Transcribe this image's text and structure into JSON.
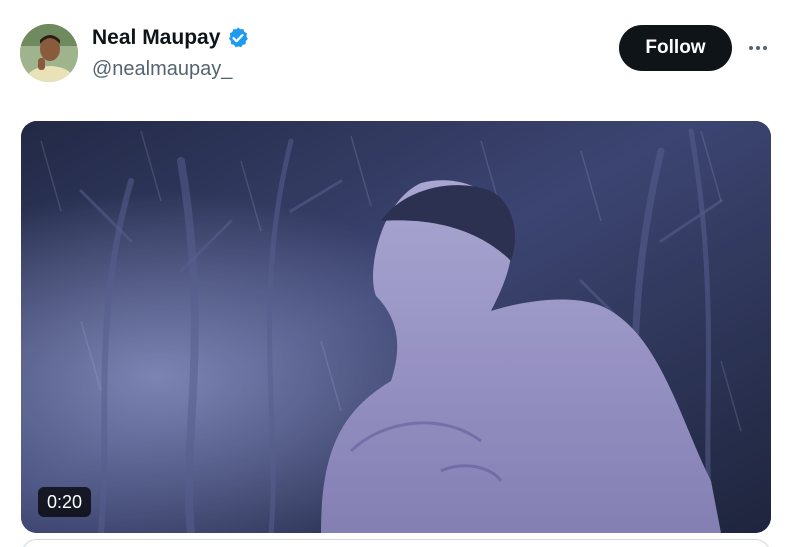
{
  "author": {
    "display_name": "Neal Maupay",
    "handle": "@nealmaupay_",
    "verified": true,
    "verified_color": "#1d9bf0"
  },
  "actions": {
    "follow_label": "Follow",
    "more_icon": "more-horizontal-icon"
  },
  "media": {
    "type": "video",
    "duration": "0:20"
  },
  "colors": {
    "text_primary": "#0f1419",
    "text_secondary": "#536471",
    "follow_bg": "#0f1419"
  }
}
